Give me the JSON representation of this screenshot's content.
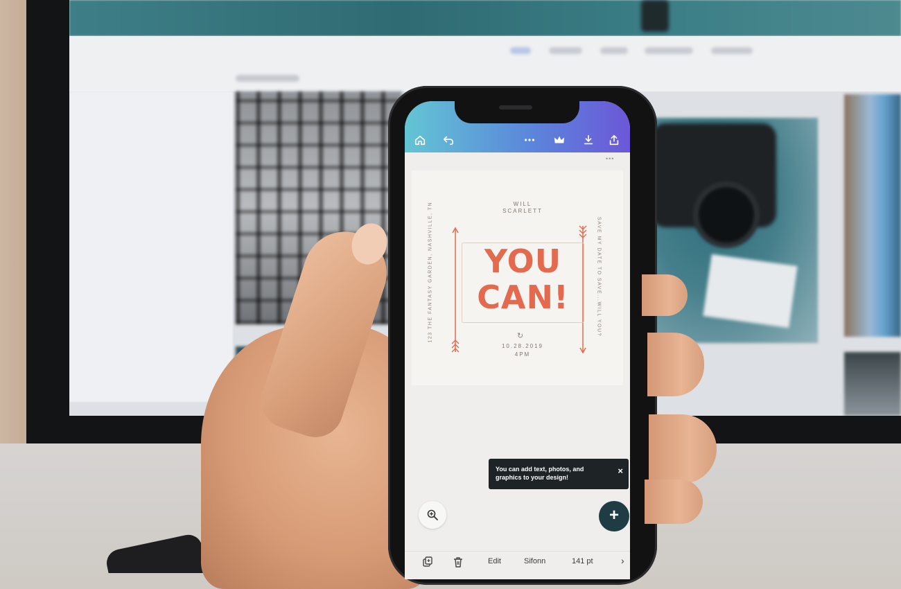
{
  "design": {
    "names": "WILL\nSCARLETT",
    "title_line1": "YOU",
    "title_line2": "CAN!",
    "date_time": "10.28.2019\n4PM",
    "side_left": "123 THE FANTASY GARDEN, NASHVILLE, TN",
    "side_right": "SAVE MY DATE TO SAVE...WILL YOU?",
    "title_color": "#e36a4e"
  },
  "topbar": {
    "icons": [
      "home-icon",
      "undo-icon",
      "more-icon",
      "crown-icon",
      "download-icon",
      "share-icon"
    ]
  },
  "tooltip": {
    "text": "You can add text, photos, and graphics to your design!",
    "close": "×"
  },
  "fab": {
    "label": "+"
  },
  "bottom_bar": {
    "edit": "Edit",
    "font": "Sifonn",
    "size": "141 pt",
    "next": "›"
  },
  "colors": {
    "topbar_start": "#63c5d4",
    "topbar_end": "#6c57d8",
    "fab": "#1f3c45",
    "accent": "#e36a4e"
  }
}
